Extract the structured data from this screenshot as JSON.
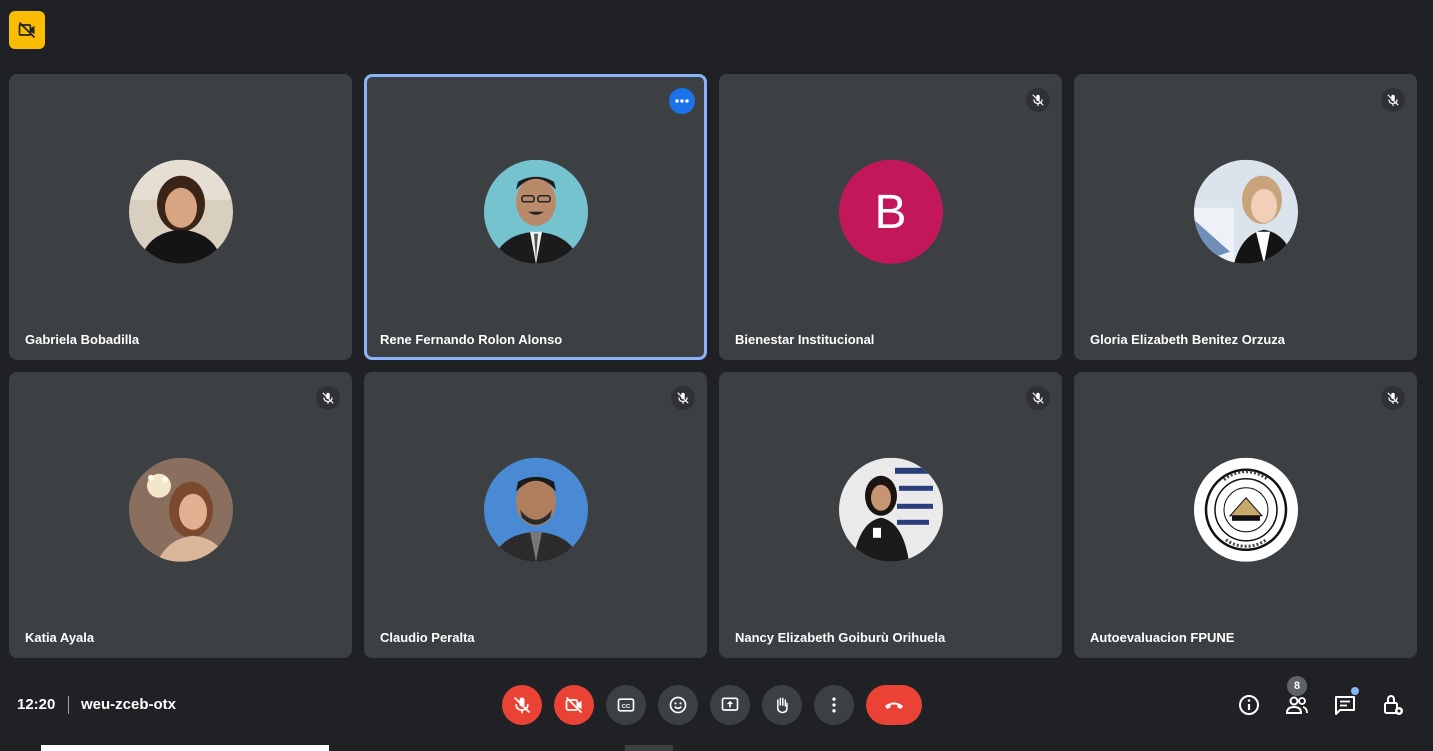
{
  "participants": [
    {
      "name": "Gabriela Bobadilla",
      "muted": false,
      "active": false,
      "avatar": "photo"
    },
    {
      "name": "Rene Fernando Rolon Alonso",
      "muted": false,
      "active": true,
      "avatar": "photo"
    },
    {
      "name": "Bienestar Institucional",
      "muted": true,
      "active": false,
      "avatar": "letter",
      "letter": "B",
      "color": "#c2185b"
    },
    {
      "name": "Gloria Elizabeth Benitez Orzuza",
      "muted": true,
      "active": false,
      "avatar": "photo"
    },
    {
      "name": "Katia Ayala",
      "muted": true,
      "active": false,
      "avatar": "photo"
    },
    {
      "name": "Claudio Peralta",
      "muted": true,
      "active": false,
      "avatar": "photo"
    },
    {
      "name": "Nancy Elizabeth Goiburù Orihuela",
      "muted": true,
      "active": false,
      "avatar": "photo"
    },
    {
      "name": "Autoevaluacion FPUNE",
      "muted": true,
      "active": false,
      "avatar": "logo"
    }
  ],
  "bottombar": {
    "time": "12:20",
    "meeting_code": "weu-zceb-otx",
    "people_count": "8"
  },
  "colors": {
    "background": "#202124",
    "tile": "#3c4043",
    "active_border": "#8ab4f8",
    "danger": "#ea4335",
    "accent": "#1a73e8",
    "warning_badge": "#fbbc04"
  },
  "icons": {
    "top_badge": "no-video-badge-icon",
    "controls": [
      "mic-off-icon",
      "video-off-icon",
      "captions-icon",
      "emoji-icon",
      "present-screen-icon",
      "raise-hand-icon",
      "more-options-icon",
      "hangup-icon"
    ],
    "right": [
      "info-icon",
      "people-icon",
      "chat-icon",
      "host-controls-lock-icon"
    ]
  }
}
